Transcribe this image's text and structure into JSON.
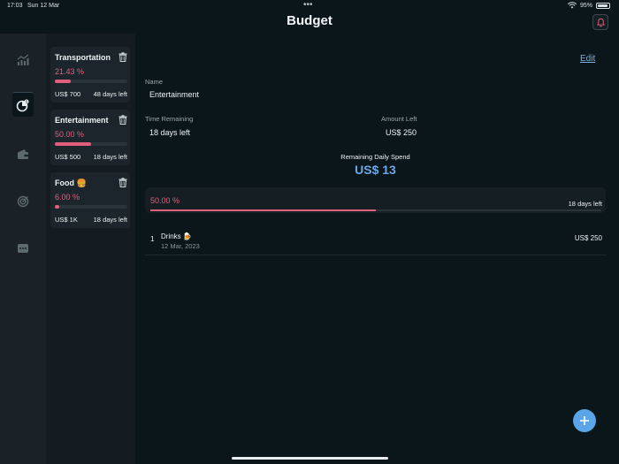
{
  "status_bar": {
    "time": "17:03",
    "date": "Sun 12 Mar",
    "dots": "•••",
    "battery": "95%"
  },
  "header": {
    "title": "Budget"
  },
  "budgets": [
    {
      "name": "Transportation",
      "percent": "21.43 %",
      "progress": 0.2143,
      "amount": "US$ 700",
      "days_left": "48 days left"
    },
    {
      "name": "Entertainment",
      "percent": "50.00 %",
      "progress": 0.5,
      "amount": "US$ 500",
      "days_left": "18 days left"
    },
    {
      "name": "Food 🍔",
      "percent": "6.00 %",
      "progress": 0.06,
      "amount": "US$ 1K",
      "days_left": "18 days left"
    }
  ],
  "detail": {
    "edit_label": "Edit",
    "name_label": "Name",
    "name_value": "Entertainment",
    "time_label": "Time Remaining",
    "time_value": "18 days left",
    "amount_label": "Amount Left",
    "amount_value": "US$ 250",
    "daily_label": "Remaining Daily Spend",
    "daily_value": "US$ 13",
    "progress_percent": "50.00 %",
    "progress_value": 0.5,
    "progress_days": "18 days left"
  },
  "transactions": [
    {
      "index": "1",
      "name": "Drinks 🍺",
      "date": "12 Mar, 2023",
      "amount": "US$ 250"
    }
  ],
  "colors": {
    "accent": "#e0607c",
    "link": "#7db3e8",
    "fab": "#5aa4e8",
    "background": "#0b161b"
  },
  "icons": {
    "rail": [
      "chart-icon",
      "budget-icon",
      "wallet-icon",
      "target-icon",
      "more-icon"
    ],
    "notification": "bell-icon",
    "add": "plus-icon",
    "delete": "trash-icon"
  }
}
